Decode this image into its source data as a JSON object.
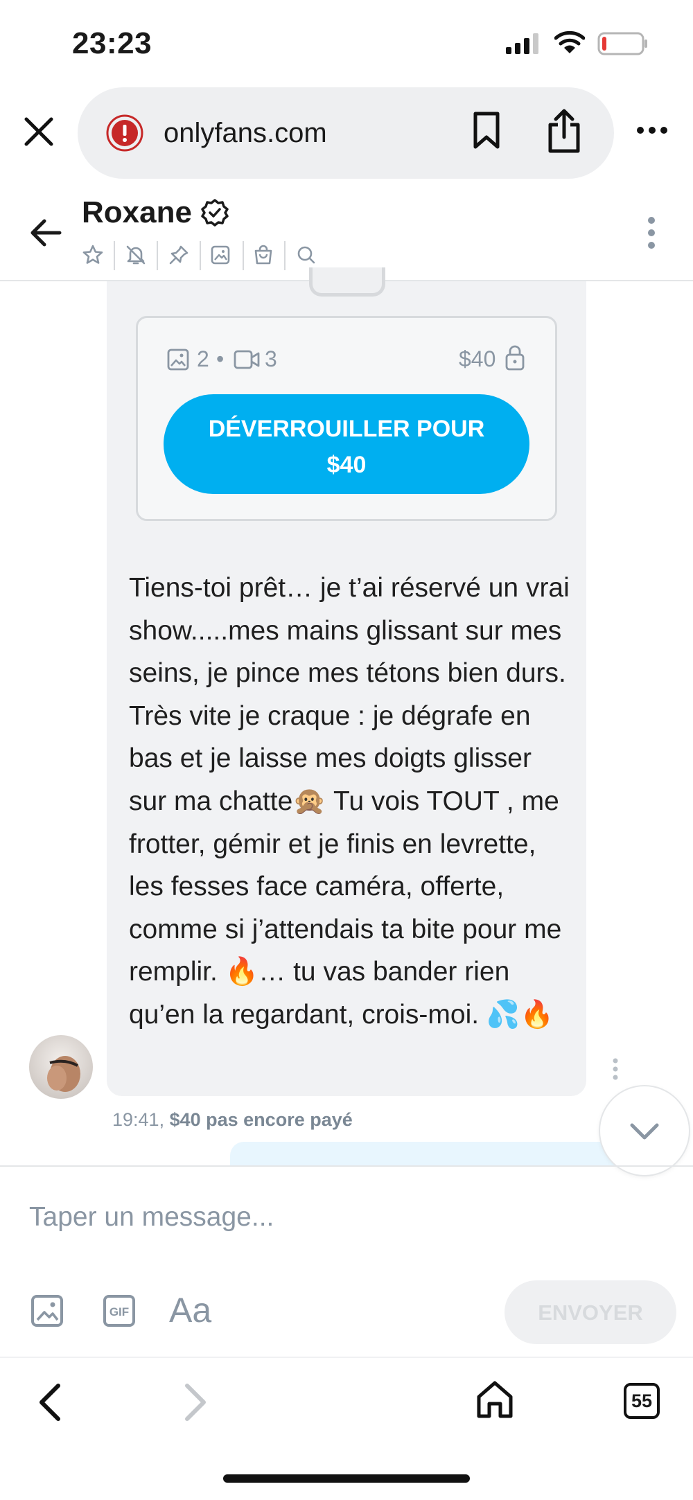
{
  "status_bar": {
    "time": "23:23",
    "battery_color": "#e53935"
  },
  "browser": {
    "url": "onlyfans.com"
  },
  "chat_header": {
    "contact_name": "Roxane",
    "icons": [
      "star-icon",
      "bell-off-icon",
      "pin-icon",
      "gallery-icon",
      "shopping-bag-icon",
      "search-icon"
    ]
  },
  "locked_post": {
    "photo_count": "2",
    "separator": "•",
    "video_count": "3",
    "price": "$40",
    "unlock_label": "DÉVERROUILLER POUR $40"
  },
  "message": {
    "text": "Tiens-toi prêt… je t’ai réservé un vrai show.....mes mains glissant sur mes seins, je pince mes tétons bien durs. Très vite je craque : je dégrafe en bas et je laisse mes doigts glisser sur ma chatte🙊 Tu vois TOUT , me frotter, gémir et je finis en levrette, les fesses face caméra, offerte, comme si j’attendais ta bite pour me remplir. 🔥… tu vas bander rien qu’en la regardant, crois-moi. 💦🔥",
    "time": "19:41,",
    "payment_status": "$40 pas encore payé"
  },
  "composer": {
    "placeholder": "Taper un message...",
    "font_label": "Aa",
    "send_label": "ENVOYER"
  },
  "browser_toolbar": {
    "tab_count": "55"
  },
  "colors": {
    "accent": "#00aff0",
    "muted": "#8a96a3",
    "bubble": "#f1f2f4"
  }
}
